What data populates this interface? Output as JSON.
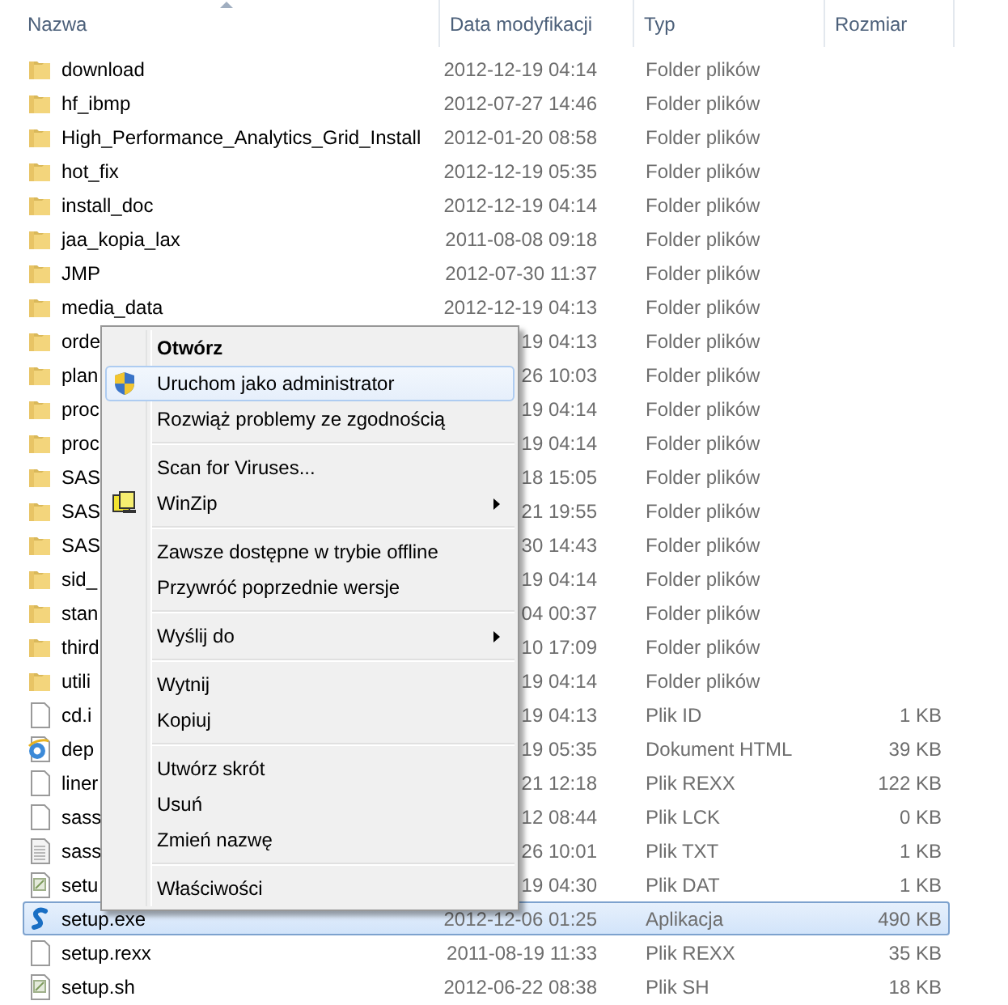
{
  "columns": [
    "Nazwa",
    "Data modyfikacji",
    "Typ",
    "Rozmiar"
  ],
  "rows": [
    {
      "kind": "folder",
      "name": "download",
      "date": "2012-12-19 04:14",
      "type": "Folder plików",
      "selected": false
    },
    {
      "kind": "folder",
      "name": "hf_ibmp",
      "date": "2012-07-27 14:46",
      "type": "Folder plików",
      "selected": false
    },
    {
      "kind": "folder",
      "name": "High_Performance_Analytics_Grid_Install",
      "date": "2012-01-20 08:58",
      "type": "Folder plików",
      "selected": false
    },
    {
      "kind": "folder",
      "name": "hot_fix",
      "date": "2012-12-19 05:35",
      "type": "Folder plików",
      "selected": false
    },
    {
      "kind": "folder",
      "name": "install_doc",
      "date": "2012-12-19 04:14",
      "type": "Folder plików",
      "selected": false
    },
    {
      "kind": "folder",
      "name": "jaa_kopia_lax",
      "date": "2011-08-08 09:18",
      "type": "Folder plików",
      "selected": false
    },
    {
      "kind": "folder",
      "name": "JMP",
      "date": "2012-07-30 11:37",
      "type": "Folder plików",
      "selected": false
    },
    {
      "kind": "folder",
      "name": "media_data",
      "date": "2012-12-19 04:13",
      "type": "Folder plików",
      "selected": false
    },
    {
      "kind": "folder",
      "name": "orde",
      "date": "19 04:13",
      "type": "Folder plików",
      "selected": false
    },
    {
      "kind": "folder",
      "name": "plan",
      "date": "26 10:03",
      "type": "Folder plików",
      "selected": false
    },
    {
      "kind": "folder",
      "name": "proc",
      "date": "19 04:14",
      "type": "Folder plików",
      "selected": false
    },
    {
      "kind": "folder",
      "name": "proc",
      "date": "19 04:14",
      "type": "Folder plików",
      "selected": false
    },
    {
      "kind": "folder",
      "name": "SAS",
      "date": "18 15:05",
      "type": "Folder plików",
      "selected": false
    },
    {
      "kind": "folder",
      "name": "SAS",
      "date": "21 19:55",
      "type": "Folder plików",
      "selected": false
    },
    {
      "kind": "folder",
      "name": "SAS",
      "date": "30 14:43",
      "type": "Folder plików",
      "selected": false
    },
    {
      "kind": "folder",
      "name": "sid_",
      "date": "19 04:14",
      "type": "Folder plików",
      "selected": false
    },
    {
      "kind": "folder",
      "name": "stan",
      "date": "04 00:37",
      "type": "Folder plików",
      "selected": false
    },
    {
      "kind": "folder",
      "name": "third",
      "date": "10 17:09",
      "type": "Folder plików",
      "selected": false
    },
    {
      "kind": "folder",
      "name": "utili",
      "date": "19 04:14",
      "type": "Folder plików",
      "selected": false
    },
    {
      "kind": "file",
      "name": "cd.i",
      "date": "19 04:13",
      "type": "Plik ID",
      "size": "1 KB",
      "selected": false
    },
    {
      "kind": "html",
      "name": "dep",
      "date": "19 05:35",
      "type": "Dokument HTML",
      "size": "39 KB",
      "selected": false
    },
    {
      "kind": "file",
      "name": "liner",
      "date": "21 12:18",
      "type": "Plik REXX",
      "size": "122 KB",
      "selected": false
    },
    {
      "kind": "file",
      "name": "sass",
      "date": "12 08:44",
      "type": "Plik LCK",
      "size": "0 KB",
      "selected": false
    },
    {
      "kind": "text",
      "name": "sass",
      "date": "26 10:01",
      "type": "Plik TXT",
      "size": "1 KB",
      "selected": false
    },
    {
      "kind": "script",
      "name": "setu",
      "date": "19 04:30",
      "type": "Plik DAT",
      "size": "1 KB",
      "selected": false
    },
    {
      "kind": "app",
      "name": "setup.exe",
      "date": "2012-12-06 01:25",
      "type": "Aplikacja",
      "size": "490 KB",
      "selected": true
    },
    {
      "kind": "file",
      "name": "setup.rexx",
      "date": "2011-08-19 11:33",
      "type": "Plik REXX",
      "size": "35 KB",
      "selected": false
    },
    {
      "kind": "script",
      "name": "setup.sh",
      "date": "2012-06-22 08:38",
      "type": "Plik SH",
      "size": "18 KB",
      "selected": false
    }
  ],
  "context_menu": [
    {
      "kind": "item",
      "label": "Otwórz",
      "bold": true,
      "selected": false
    },
    {
      "kind": "shield",
      "label": "Uruchom jako administrator",
      "selected": true
    },
    {
      "kind": "item",
      "label": "Rozwiąż problemy ze zgodnością",
      "selected": false
    },
    {
      "kind": "separator"
    },
    {
      "kind": "item",
      "label": "Scan for Viruses...",
      "selected": false
    },
    {
      "kind": "archive",
      "label": "WinZip",
      "submenu": true,
      "selected": false
    },
    {
      "kind": "separator"
    },
    {
      "kind": "item",
      "label": "Zawsze dostępne w trybie offline",
      "selected": false
    },
    {
      "kind": "item",
      "label": "Przywróć poprzednie wersje",
      "selected": false
    },
    {
      "kind": "separator"
    },
    {
      "kind": "item",
      "label": "Wyślij do",
      "submenu": true,
      "selected": false
    },
    {
      "kind": "separator"
    },
    {
      "kind": "item",
      "label": "Wytnij",
      "selected": false
    },
    {
      "kind": "item",
      "label": "Kopiuj",
      "selected": false
    },
    {
      "kind": "separator"
    },
    {
      "kind": "item",
      "label": "Utwórz skrót",
      "selected": false
    },
    {
      "kind": "item",
      "label": "Usuń",
      "selected": false
    },
    {
      "kind": "item",
      "label": "Zmień nazwę",
      "selected": false
    },
    {
      "kind": "separator"
    },
    {
      "kind": "item",
      "label": "Właściwości",
      "selected": false
    }
  ]
}
